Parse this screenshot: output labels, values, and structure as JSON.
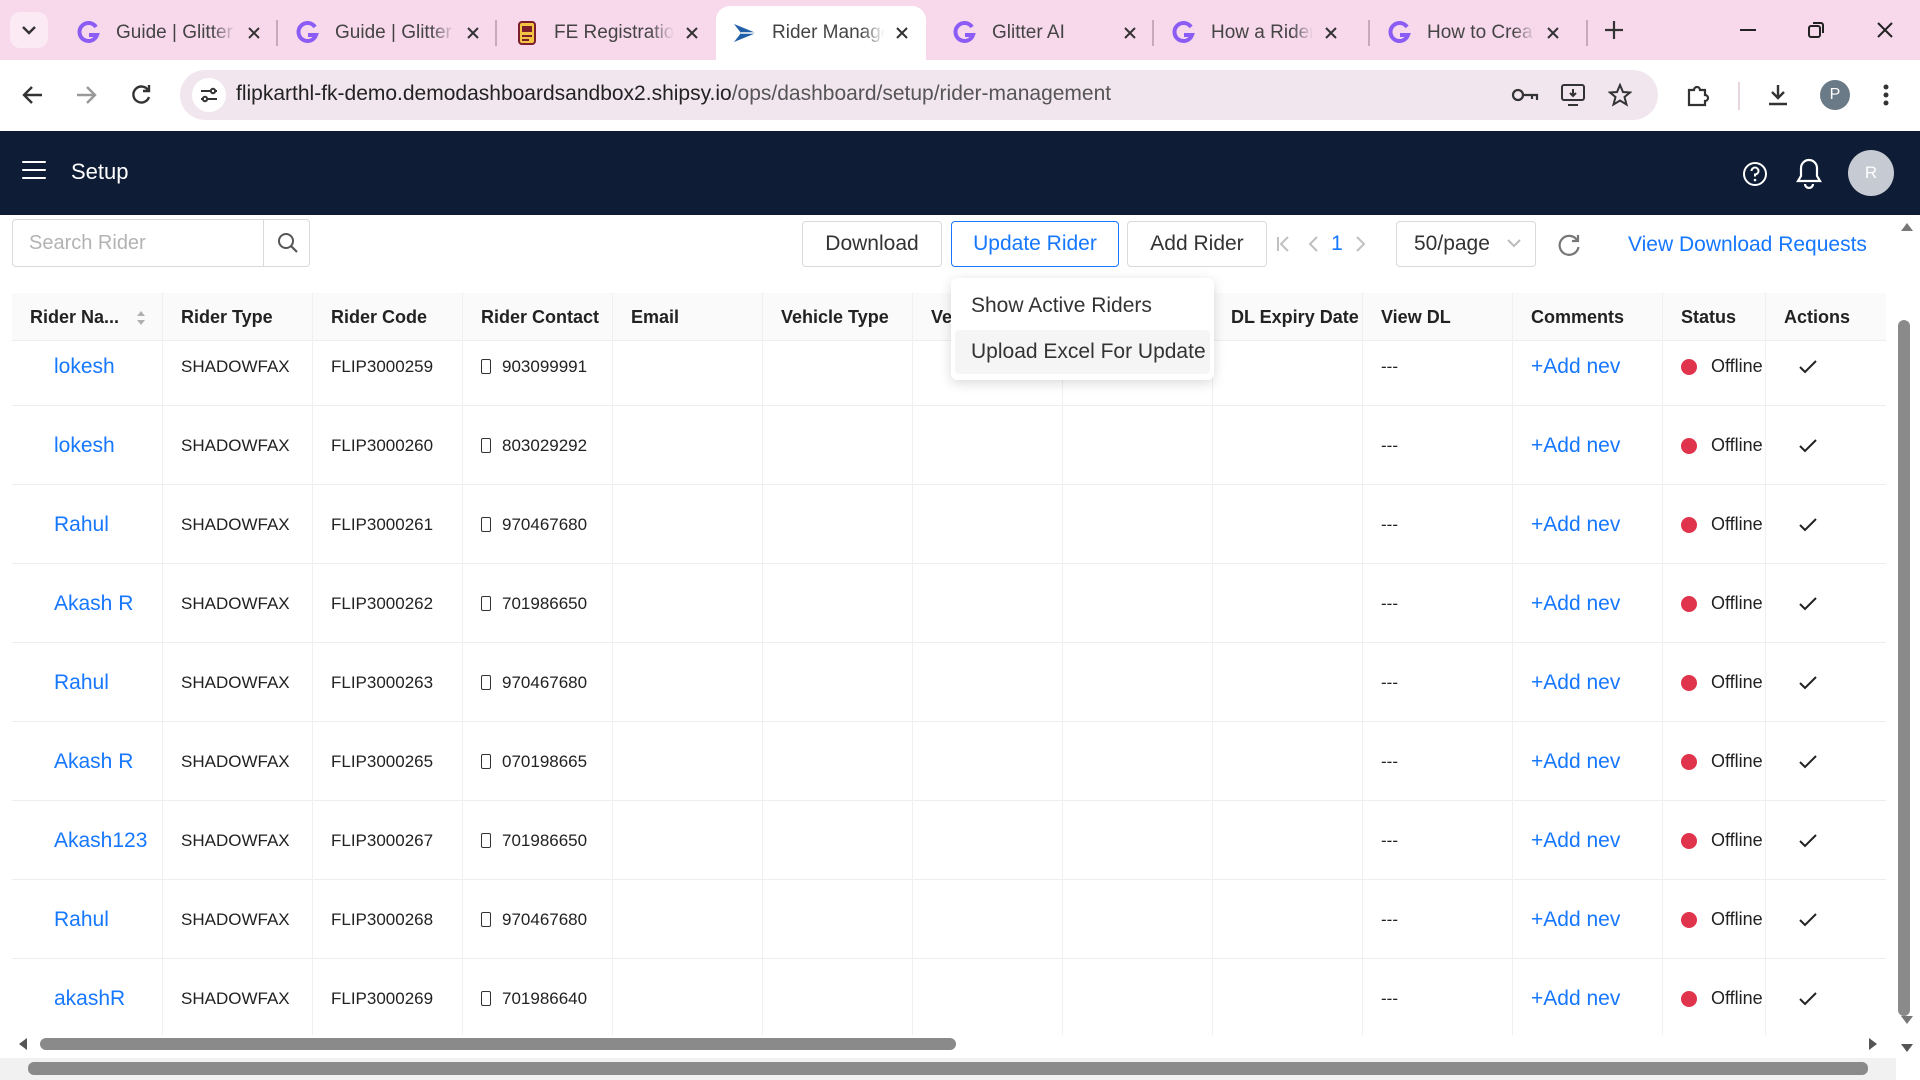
{
  "browser": {
    "tabs": [
      {
        "title": "Guide | Glitter"
      },
      {
        "title": "Guide | Glitter"
      },
      {
        "title": "FE Registration"
      },
      {
        "title": "Rider Manage"
      },
      {
        "title": "Glitter AI"
      },
      {
        "title": "How a Rider r"
      },
      {
        "title": "How to Create"
      }
    ],
    "url_domain": "flipkarthl-fk-demo.demodashboardsandbox2.shipsy.io",
    "url_path": "/ops/dashboard/setup/rider-management",
    "profile_initial": "P"
  },
  "app": {
    "title": "Setup",
    "avatar_initial": "R"
  },
  "toolbar": {
    "search_placeholder": "Search Rider",
    "download_label": "Download",
    "update_rider_label": "Update Rider",
    "add_rider_label": "Add Rider",
    "current_page": "1",
    "page_size": "50/page",
    "view_download_requests": "View Download Requests"
  },
  "dropdown": {
    "items": [
      "Show Active Riders",
      "Upload Excel For Update"
    ]
  },
  "table": {
    "columns": [
      "Rider Na...",
      "Rider Type",
      "Rider Code",
      "Rider Contact",
      "Email",
      "Vehicle Type",
      "Ve",
      "",
      "DL Expiry Date",
      "View DL",
      "Comments",
      "Status",
      "Actions"
    ],
    "rows": [
      {
        "name": "lokesh",
        "type": "SHADOWFAX",
        "code": "FLIP3000259",
        "contact": "903099991",
        "view_dl": "---",
        "comments": "+Add nev",
        "status": "Offline"
      },
      {
        "name": "lokesh",
        "type": "SHADOWFAX",
        "code": "FLIP3000260",
        "contact": "803029292",
        "view_dl": "---",
        "comments": "+Add nev",
        "status": "Offline"
      },
      {
        "name": "Rahul",
        "type": "SHADOWFAX",
        "code": "FLIP3000261",
        "contact": "970467680",
        "view_dl": "---",
        "comments": "+Add nev",
        "status": "Offline"
      },
      {
        "name": "Akash R",
        "type": "SHADOWFAX",
        "code": "FLIP3000262",
        "contact": "701986650",
        "view_dl": "---",
        "comments": "+Add nev",
        "status": "Offline"
      },
      {
        "name": "Rahul",
        "type": "SHADOWFAX",
        "code": "FLIP3000263",
        "contact": "970467680",
        "view_dl": "---",
        "comments": "+Add nev",
        "status": "Offline"
      },
      {
        "name": "Akash R",
        "type": "SHADOWFAX",
        "code": "FLIP3000265",
        "contact": "070198665",
        "view_dl": "---",
        "comments": "+Add nev",
        "status": "Offline"
      },
      {
        "name": "Akash123",
        "type": "SHADOWFAX",
        "code": "FLIP3000267",
        "contact": "701986650",
        "view_dl": "---",
        "comments": "+Add nev",
        "status": "Offline"
      },
      {
        "name": "Rahul",
        "type": "SHADOWFAX",
        "code": "FLIP3000268",
        "contact": "970467680",
        "view_dl": "---",
        "comments": "+Add nev",
        "status": "Offline"
      },
      {
        "name": "akashR",
        "type": "SHADOWFAX",
        "code": "FLIP3000269",
        "contact": "701986640",
        "view_dl": "---",
        "comments": "+Add nev",
        "status": "Offline"
      }
    ]
  },
  "colors": {
    "header_bg": "#0e1c35",
    "accent": "#1677ff",
    "offline": "#e0334c",
    "tabbar_bg": "#f8d9ec"
  }
}
